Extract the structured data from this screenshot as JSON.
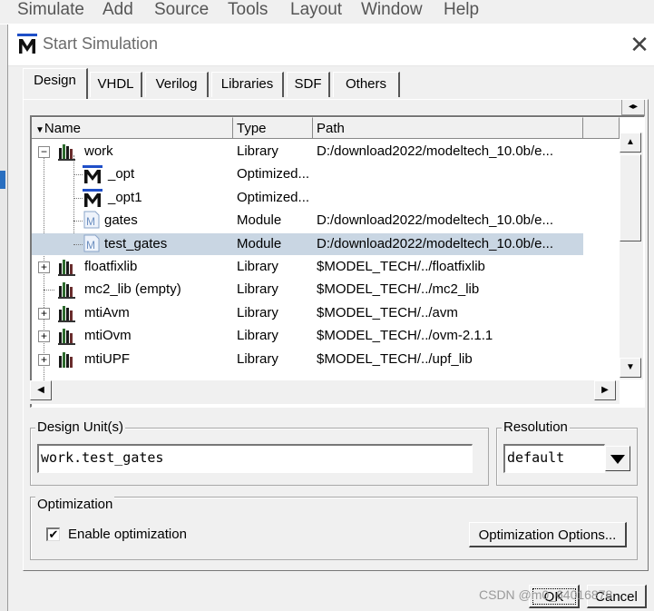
{
  "menubar": {
    "items": [
      "Simulate",
      "Add",
      "Source",
      "Tools",
      "Layout",
      "Window",
      "Help"
    ]
  },
  "dialog": {
    "title": "Start Simulation",
    "close_glyph": "✕"
  },
  "tabs": [
    "Design",
    "VHDL",
    "Verilog",
    "Libraries",
    "SDF",
    "Others"
  ],
  "active_tab": "Design",
  "tab_scroll_glyph": "◂▸",
  "list": {
    "columns": [
      "Name",
      "Type",
      "Path"
    ],
    "rows": [
      {
        "name": "work",
        "type": "Library",
        "path": "D:/download2022/modeltech_10.0b/e..."
      },
      {
        "name": "_opt",
        "type": "Optimized...",
        "path": ""
      },
      {
        "name": "_opt1",
        "type": "Optimized...",
        "path": ""
      },
      {
        "name": "gates",
        "type": "Module",
        "path": "D:/download2022/modeltech_10.0b/e..."
      },
      {
        "name": "test_gates",
        "type": "Module",
        "path": "D:/download2022/modeltech_10.0b/e..."
      },
      {
        "name": "floatfixlib",
        "type": "Library",
        "path": "$MODEL_TECH/../floatfixlib"
      },
      {
        "name": "mc2_lib  (empty)",
        "type": "Library",
        "path": "$MODEL_TECH/../mc2_lib"
      },
      {
        "name": "mtiAvm",
        "type": "Library",
        "path": "$MODEL_TECH/../avm"
      },
      {
        "name": "mtiOvm",
        "type": "Library",
        "path": "$MODEL_TECH/../ovm-2.1.1"
      },
      {
        "name": "mtiUPF",
        "type": "Library",
        "path": "$MODEL_TECH/../upf_lib"
      }
    ],
    "selected_row": "test_gates"
  },
  "design_unit": {
    "label": "Design Unit(s)",
    "value": "work.test_gates"
  },
  "resolution": {
    "label": "Resolution",
    "value": "default"
  },
  "optimization": {
    "label": "Optimization",
    "checkbox_label": "Enable optimization",
    "checked": true,
    "options_button": "Optimization Options..."
  },
  "footer": {
    "ok_button": "OK",
    "cancel_button": "Cancel"
  },
  "watermark": "CSDN @m0_64016878",
  "colors": {
    "selection": "#c9d6e3",
    "dialog_bg": "#f0f0f0",
    "logo_blue": "#1f4fc8"
  }
}
